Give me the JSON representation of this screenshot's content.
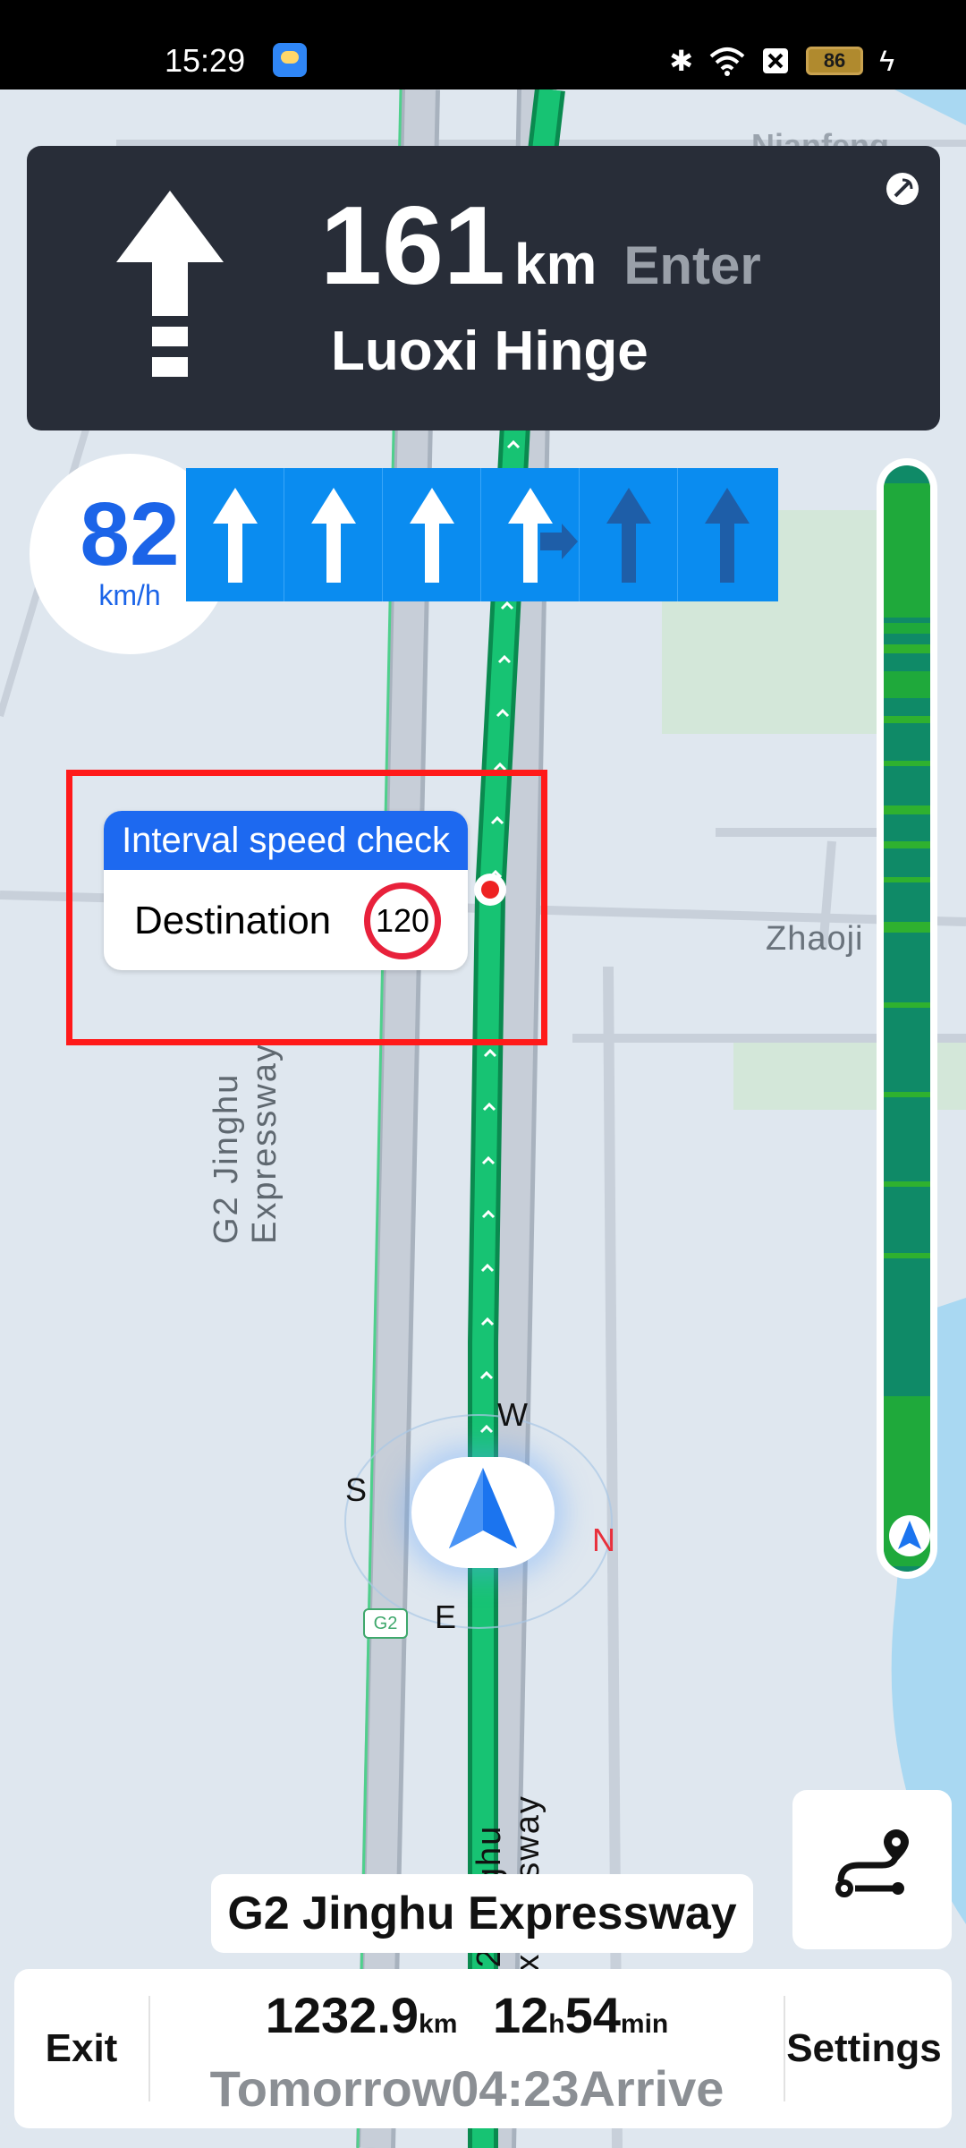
{
  "status_bar": {
    "time": "15:29",
    "battery": "86",
    "icons": [
      "bluetooth-icon",
      "wifi-icon",
      "sim-off-icon",
      "battery-icon",
      "charging-icon"
    ]
  },
  "map": {
    "label_zhaoji": "Zhaoji",
    "label_zhaoji_suffix": "a",
    "label_top": "Nianfeng",
    "road_left_label": "G2 Jinghu Expressway",
    "road_right_label": "G2 Jinghu Expressway",
    "shield_label": "G2",
    "colors": {
      "route_green": "#14b36b",
      "background": "#dfe7ef",
      "road": "#c5ccd6",
      "water": "#a9d8f2",
      "park": "#cfe5d5"
    }
  },
  "guidance": {
    "distance": "161",
    "unit": "km",
    "action": "Enter",
    "road": "Luoxi Hinge",
    "icons": [
      "straight-arrow-icon",
      "satellite-icon"
    ]
  },
  "speed": {
    "value": "82",
    "unit": "km/h"
  },
  "lanes": {
    "items": [
      {
        "type": "straight",
        "active": true
      },
      {
        "type": "straight",
        "active": true
      },
      {
        "type": "straight",
        "active": true
      },
      {
        "type": "straight-right",
        "active": true
      },
      {
        "type": "straight",
        "active": false
      },
      {
        "type": "straight",
        "active": false
      }
    ],
    "color": "#0a8cf0"
  },
  "speed_check": {
    "title": "Interval speed check",
    "destination": "Destination",
    "limit": "120"
  },
  "compass": {
    "w": "W",
    "s": "S",
    "n": "N",
    "e": "E"
  },
  "current_road": "G2 Jinghu Expressway",
  "bottom": {
    "exit": "Exit",
    "settings": "Settings",
    "distance": "1232.9",
    "distance_unit": "km",
    "hours": "12",
    "hours_unit": "h",
    "minutes": "54",
    "minutes_unit": "min",
    "arrival": "Tomorrow04:23Arrive"
  }
}
